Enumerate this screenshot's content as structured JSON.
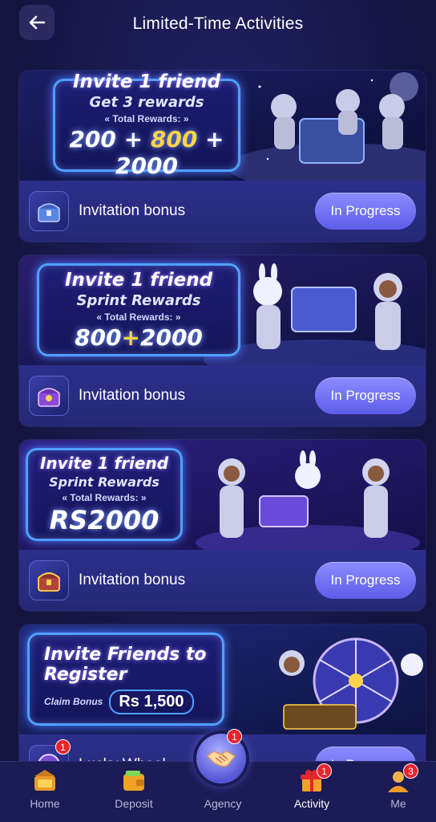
{
  "header": {
    "title": "Limited-Time Activities"
  },
  "activities": [
    {
      "promo_line1": "Invite 1 friend",
      "promo_line2": "Get 3 rewards",
      "promo_line3": "« Total Rewards: »",
      "promo_amount_a": "200 + ",
      "promo_amount_b": "800",
      "promo_amount_c": " + 2000",
      "label": "Invitation bonus",
      "status": "In Progress"
    },
    {
      "promo_line1": "Invite 1 friend",
      "promo_line2": "Sprint Rewards",
      "promo_line3": "« Total Rewards: »",
      "promo_amount_a": "800",
      "promo_amount_b": "+",
      "promo_amount_c": "2000",
      "label": "Invitation bonus",
      "status": "In Progress"
    },
    {
      "promo_line1": "Invite 1 friend",
      "promo_line2": "Sprint Rewards",
      "promo_line3": "« Total Rewards: »",
      "promo_amount_a": "RS",
      "promo_amount_b": "",
      "promo_amount_c": "2000",
      "label": "Invitation bonus",
      "status": "In Progress"
    },
    {
      "promo_line1": "Invite Friends to",
      "promo_line2": "Register",
      "promo_line3": "Claim Bonus",
      "promo_amount_a": "Rs 1,500",
      "promo_amount_b": "",
      "promo_amount_c": "",
      "label": "Lucky Wheel",
      "status": "In Progress"
    }
  ],
  "nav": {
    "home": "Home",
    "deposit": "Deposit",
    "agency": "Agency",
    "activity": "Activity",
    "me": "Me",
    "badges": {
      "lucky_wheel": "1",
      "agency": "1",
      "activity": "1",
      "me": "3"
    }
  },
  "colors": {
    "accent": "#6d6ff0",
    "badge": "#e8242f",
    "background": "#16164a"
  }
}
